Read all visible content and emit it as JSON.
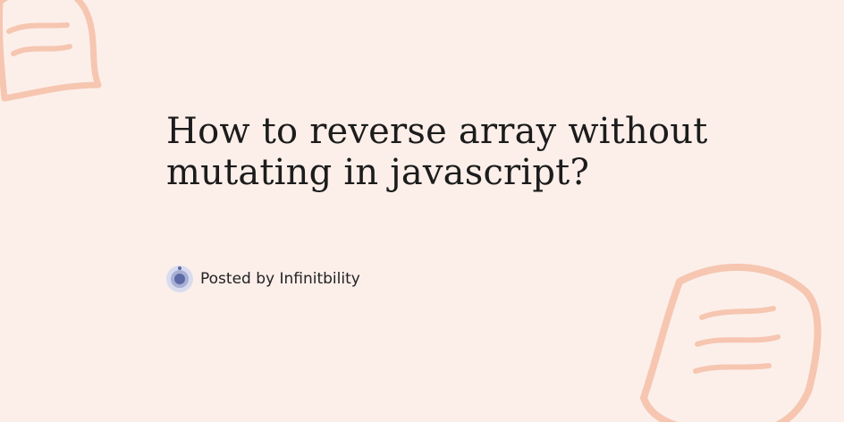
{
  "post": {
    "title_line1": "How to reverse array without",
    "title_line2": "mutating in javascript?",
    "posted_by": "Posted by Infinitbility"
  },
  "icons": {
    "avatar": "infinitbility-logo-icon",
    "decoration": "note-doodle-icon"
  },
  "colors": {
    "background": "#fcefea",
    "doodle": "#f6c6b1",
    "title_text": "#1c1c1c",
    "avatar_accent": "#5c6aa6"
  }
}
